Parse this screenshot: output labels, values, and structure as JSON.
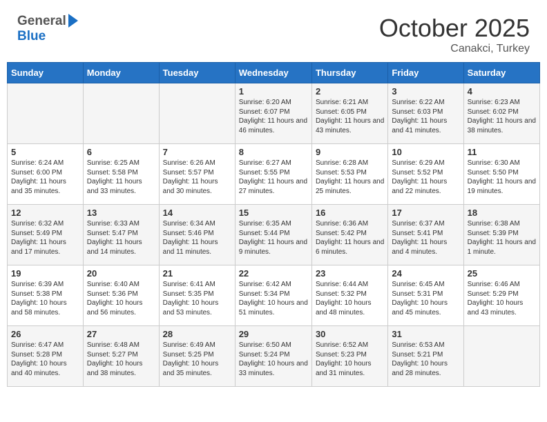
{
  "header": {
    "logo_general": "General",
    "logo_blue": "Blue",
    "month": "October 2025",
    "location": "Canakci, Turkey"
  },
  "days_of_week": [
    "Sunday",
    "Monday",
    "Tuesday",
    "Wednesday",
    "Thursday",
    "Friday",
    "Saturday"
  ],
  "weeks": [
    [
      {
        "day": "",
        "content": ""
      },
      {
        "day": "",
        "content": ""
      },
      {
        "day": "",
        "content": ""
      },
      {
        "day": "1",
        "content": "Sunrise: 6:20 AM\nSunset: 6:07 PM\nDaylight: 11 hours and 46 minutes."
      },
      {
        "day": "2",
        "content": "Sunrise: 6:21 AM\nSunset: 6:05 PM\nDaylight: 11 hours and 43 minutes."
      },
      {
        "day": "3",
        "content": "Sunrise: 6:22 AM\nSunset: 6:03 PM\nDaylight: 11 hours and 41 minutes."
      },
      {
        "day": "4",
        "content": "Sunrise: 6:23 AM\nSunset: 6:02 PM\nDaylight: 11 hours and 38 minutes."
      }
    ],
    [
      {
        "day": "5",
        "content": "Sunrise: 6:24 AM\nSunset: 6:00 PM\nDaylight: 11 hours and 35 minutes."
      },
      {
        "day": "6",
        "content": "Sunrise: 6:25 AM\nSunset: 5:58 PM\nDaylight: 11 hours and 33 minutes."
      },
      {
        "day": "7",
        "content": "Sunrise: 6:26 AM\nSunset: 5:57 PM\nDaylight: 11 hours and 30 minutes."
      },
      {
        "day": "8",
        "content": "Sunrise: 6:27 AM\nSunset: 5:55 PM\nDaylight: 11 hours and 27 minutes."
      },
      {
        "day": "9",
        "content": "Sunrise: 6:28 AM\nSunset: 5:53 PM\nDaylight: 11 hours and 25 minutes."
      },
      {
        "day": "10",
        "content": "Sunrise: 6:29 AM\nSunset: 5:52 PM\nDaylight: 11 hours and 22 minutes."
      },
      {
        "day": "11",
        "content": "Sunrise: 6:30 AM\nSunset: 5:50 PM\nDaylight: 11 hours and 19 minutes."
      }
    ],
    [
      {
        "day": "12",
        "content": "Sunrise: 6:32 AM\nSunset: 5:49 PM\nDaylight: 11 hours and 17 minutes."
      },
      {
        "day": "13",
        "content": "Sunrise: 6:33 AM\nSunset: 5:47 PM\nDaylight: 11 hours and 14 minutes."
      },
      {
        "day": "14",
        "content": "Sunrise: 6:34 AM\nSunset: 5:46 PM\nDaylight: 11 hours and 11 minutes."
      },
      {
        "day": "15",
        "content": "Sunrise: 6:35 AM\nSunset: 5:44 PM\nDaylight: 11 hours and 9 minutes."
      },
      {
        "day": "16",
        "content": "Sunrise: 6:36 AM\nSunset: 5:42 PM\nDaylight: 11 hours and 6 minutes."
      },
      {
        "day": "17",
        "content": "Sunrise: 6:37 AM\nSunset: 5:41 PM\nDaylight: 11 hours and 4 minutes."
      },
      {
        "day": "18",
        "content": "Sunrise: 6:38 AM\nSunset: 5:39 PM\nDaylight: 11 hours and 1 minute."
      }
    ],
    [
      {
        "day": "19",
        "content": "Sunrise: 6:39 AM\nSunset: 5:38 PM\nDaylight: 10 hours and 58 minutes."
      },
      {
        "day": "20",
        "content": "Sunrise: 6:40 AM\nSunset: 5:36 PM\nDaylight: 10 hours and 56 minutes."
      },
      {
        "day": "21",
        "content": "Sunrise: 6:41 AM\nSunset: 5:35 PM\nDaylight: 10 hours and 53 minutes."
      },
      {
        "day": "22",
        "content": "Sunrise: 6:42 AM\nSunset: 5:34 PM\nDaylight: 10 hours and 51 minutes."
      },
      {
        "day": "23",
        "content": "Sunrise: 6:44 AM\nSunset: 5:32 PM\nDaylight: 10 hours and 48 minutes."
      },
      {
        "day": "24",
        "content": "Sunrise: 6:45 AM\nSunset: 5:31 PM\nDaylight: 10 hours and 45 minutes."
      },
      {
        "day": "25",
        "content": "Sunrise: 6:46 AM\nSunset: 5:29 PM\nDaylight: 10 hours and 43 minutes."
      }
    ],
    [
      {
        "day": "26",
        "content": "Sunrise: 6:47 AM\nSunset: 5:28 PM\nDaylight: 10 hours and 40 minutes."
      },
      {
        "day": "27",
        "content": "Sunrise: 6:48 AM\nSunset: 5:27 PM\nDaylight: 10 hours and 38 minutes."
      },
      {
        "day": "28",
        "content": "Sunrise: 6:49 AM\nSunset: 5:25 PM\nDaylight: 10 hours and 35 minutes."
      },
      {
        "day": "29",
        "content": "Sunrise: 6:50 AM\nSunset: 5:24 PM\nDaylight: 10 hours and 33 minutes."
      },
      {
        "day": "30",
        "content": "Sunrise: 6:52 AM\nSunset: 5:23 PM\nDaylight: 10 hours and 31 minutes."
      },
      {
        "day": "31",
        "content": "Sunrise: 6:53 AM\nSunset: 5:21 PM\nDaylight: 10 hours and 28 minutes."
      },
      {
        "day": "",
        "content": ""
      }
    ]
  ]
}
